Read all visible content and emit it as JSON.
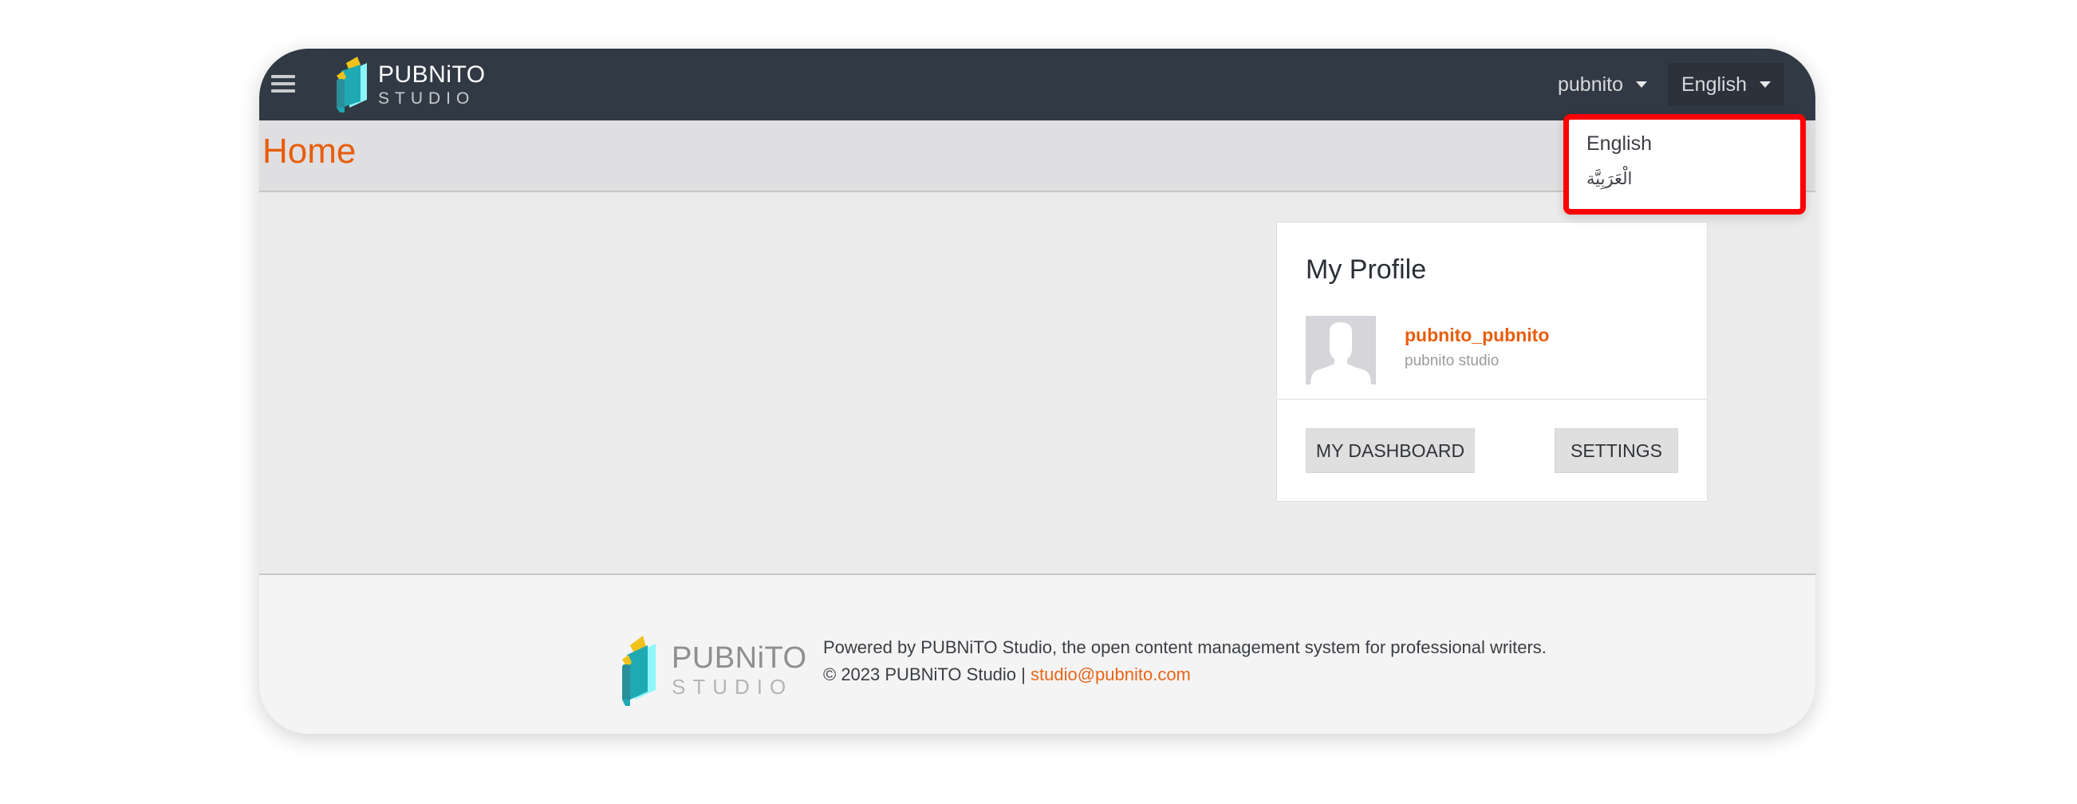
{
  "navbar": {
    "brand_line1": "PUBNiTO",
    "brand_line2": "STUDIO",
    "user_menu_label": "pubnito",
    "language_menu_label": "English",
    "colors": {
      "background": "#313a44",
      "accent": "#e85d0c"
    }
  },
  "language_dropdown": {
    "options": [
      {
        "label": "English"
      },
      {
        "label": "الْعَرَبِيَّة"
      }
    ]
  },
  "page": {
    "title": "Home"
  },
  "profile_card": {
    "heading": "My Profile",
    "username": "pubnito_pubnito",
    "subtitle": "pubnito studio",
    "dashboard_button": "MY DASHBOARD",
    "settings_button": "SETTINGS"
  },
  "footer": {
    "logo_line1": "PUBNiTO",
    "logo_line2": "STUDIO",
    "powered_by": "Powered by PUBNiTO Studio, the open content management system for professional writers.",
    "copyright": "© 2023 PUBNiTO Studio | ",
    "email": "studio@pubnito.com"
  }
}
